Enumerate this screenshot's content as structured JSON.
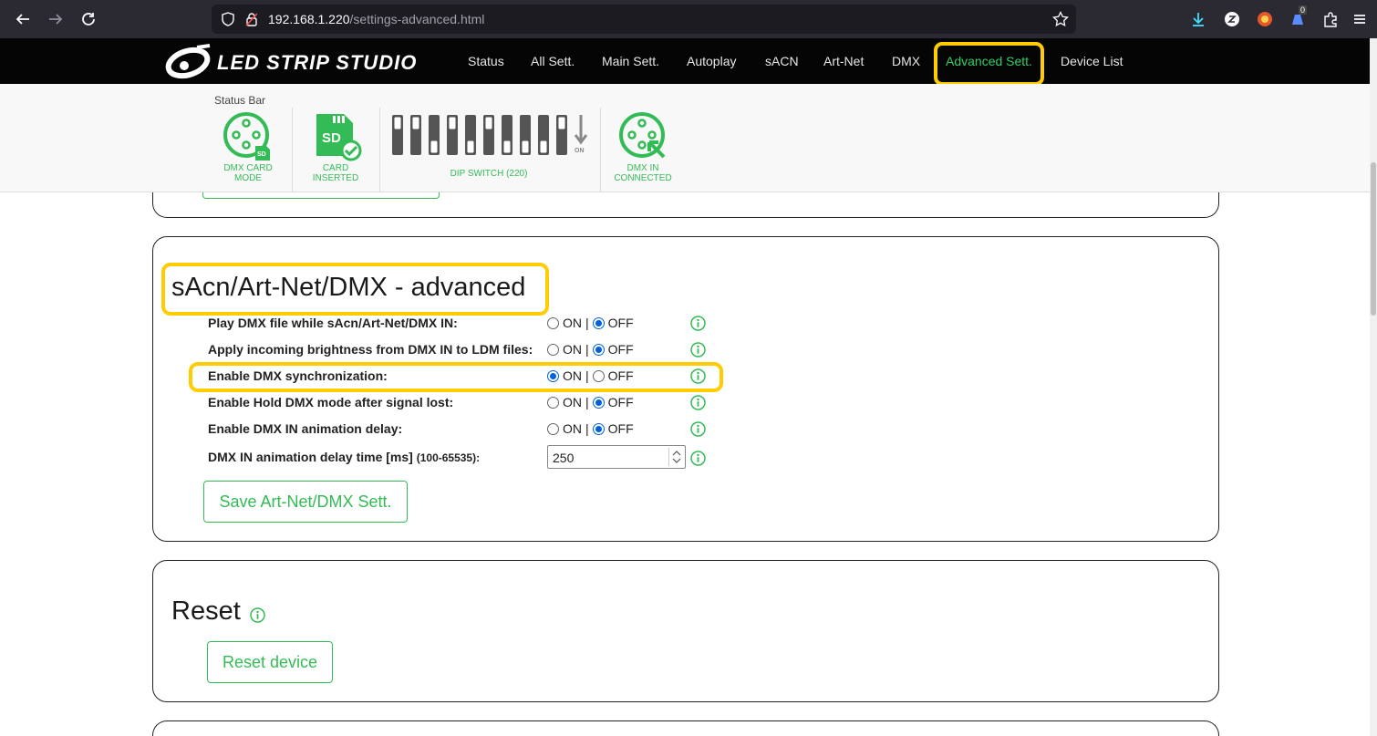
{
  "browser": {
    "url_host": "192.168.1.220",
    "url_path": "/settings-advanced.html",
    "extension_badge": "0"
  },
  "site": {
    "logo_text": "LED STRIP STUDIO",
    "nav": [
      {
        "label": "Status"
      },
      {
        "label": "All Sett."
      },
      {
        "label": "Main Sett."
      },
      {
        "label": "Autoplay"
      },
      {
        "label": "sACN"
      },
      {
        "label": "Art-Net"
      },
      {
        "label": "DMX"
      },
      {
        "label": "Advanced Sett.",
        "active": true
      },
      {
        "label": "Device List"
      }
    ]
  },
  "status_bar": {
    "title": "Status Bar",
    "dmx_card_mode": {
      "line1": "DMX CARD",
      "line2": "MODE",
      "badge": "SD"
    },
    "card_inserted": {
      "line1": "CARD",
      "line2": "INSERTED",
      "badge": "SD"
    },
    "dip_switch": {
      "label": "DIP SWITCH (220)",
      "on_label": "ON"
    },
    "dmx_in": {
      "line1": "DMX IN",
      "line2": "CONNECTED"
    }
  },
  "advanced": {
    "title": "sAcn/Art-Net/DMX - advanced",
    "on_label": "ON",
    "off_label": "OFF",
    "separator": "|",
    "settings": [
      {
        "label": "Play DMX file while sAcn/Art-Net/DMX IN:",
        "value": "OFF"
      },
      {
        "label": "Apply incoming brightness from DMX IN to LDM files:",
        "value": "OFF"
      },
      {
        "label": "Enable DMX synchronization:",
        "value": "ON"
      },
      {
        "label": "Enable Hold DMX mode after signal lost:",
        "value": "OFF"
      },
      {
        "label": "Enable DMX IN animation delay:",
        "value": "OFF"
      }
    ],
    "delay": {
      "label": "DMX IN animation delay time [ms]",
      "range": "(100-65535):",
      "value": "250"
    },
    "save_button": "Save Art-Net/DMX Sett."
  },
  "reset": {
    "title": "Reset",
    "button": "Reset device"
  },
  "colors": {
    "accent_green": "#33bb55",
    "highlight_yellow": "#ffcc00",
    "radio_blue": "#0060df",
    "header_bg": "#050505"
  }
}
